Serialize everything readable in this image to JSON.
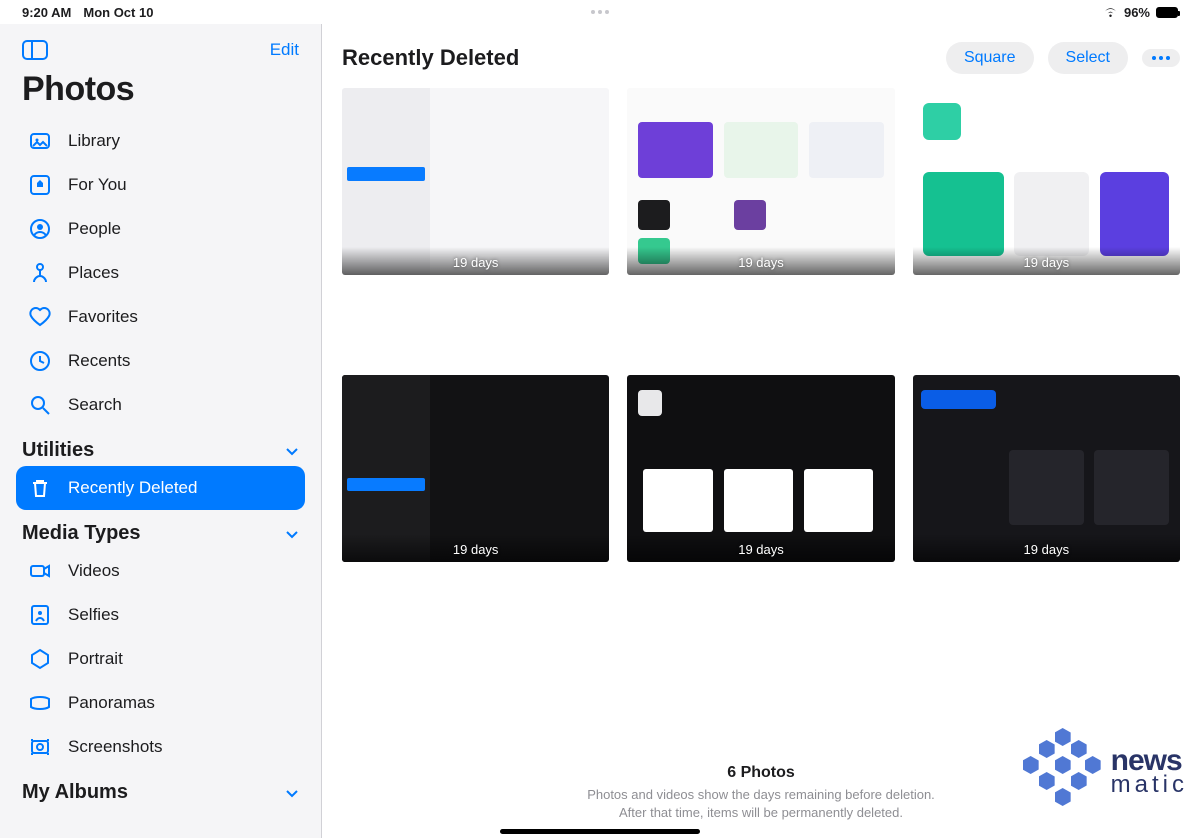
{
  "status": {
    "time": "9:20 AM",
    "date": "Mon Oct 10",
    "battery": "96%"
  },
  "sidebar": {
    "edit": "Edit",
    "title": "Photos",
    "primary": [
      {
        "label": "Library"
      },
      {
        "label": "For You"
      },
      {
        "label": "People"
      },
      {
        "label": "Places"
      },
      {
        "label": "Favorites"
      },
      {
        "label": "Recents"
      },
      {
        "label": "Search"
      }
    ],
    "sections": {
      "utilities": "Utilities",
      "recently_deleted": "Recently Deleted",
      "media_types": "Media Types",
      "my_albums": "My Albums"
    },
    "media": [
      {
        "label": "Videos"
      },
      {
        "label": "Selfies"
      },
      {
        "label": "Portrait"
      },
      {
        "label": "Panoramas"
      },
      {
        "label": "Screenshots"
      }
    ]
  },
  "main": {
    "title": "Recently Deleted",
    "actions": {
      "square": "Square",
      "select": "Select"
    },
    "items": [
      {
        "days": "19 days"
      },
      {
        "days": "19 days"
      },
      {
        "days": "19 days"
      },
      {
        "days": "19 days"
      },
      {
        "days": "19 days"
      },
      {
        "days": "19 days"
      }
    ],
    "footer": {
      "count": "6 Photos",
      "hint1": "Photos and videos show the days remaining before deletion.",
      "hint2": "After that time, items will be permanently deleted."
    }
  },
  "watermark": {
    "line1": "news",
    "line2": "matic"
  }
}
